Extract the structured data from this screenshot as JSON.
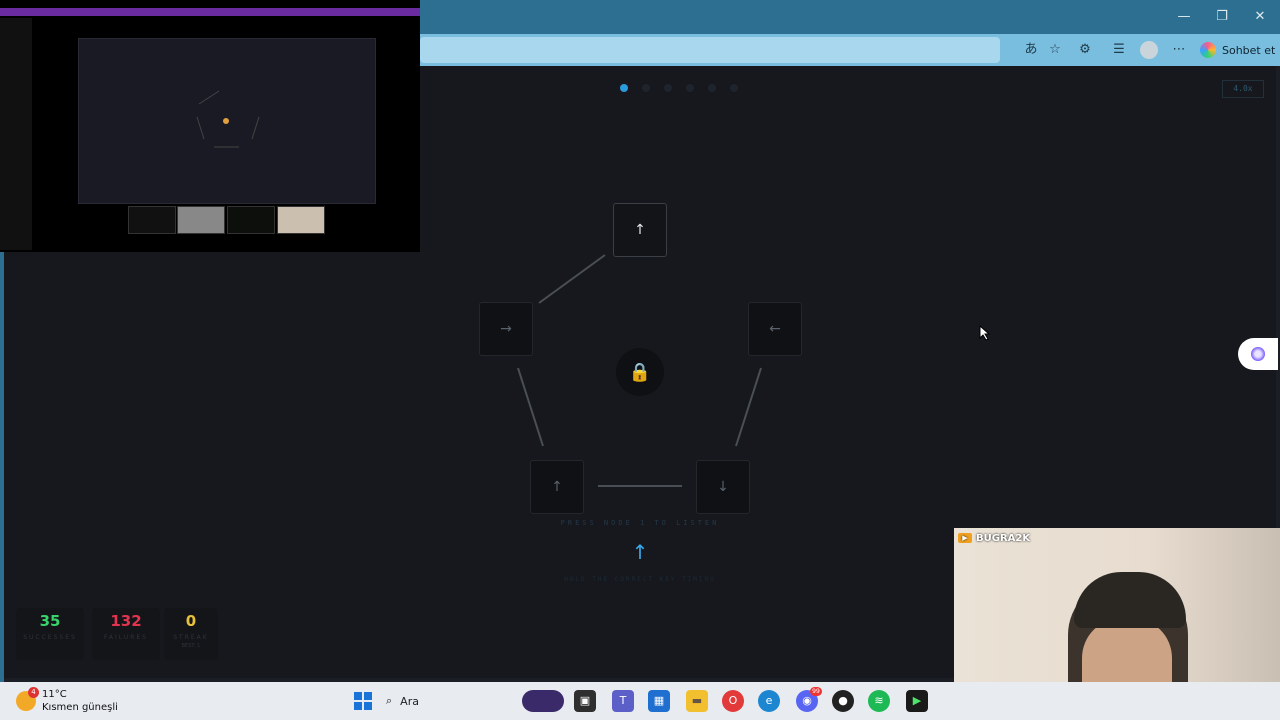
{
  "browser": {
    "copilot_label": "Sohbet et",
    "window_controls": [
      "minimize-icon",
      "restore-icon",
      "close-icon"
    ],
    "toolbar_icons": [
      "translate-icon",
      "favorite-star-icon",
      "extensions-icon",
      "favorites-icon",
      "profile-icon",
      "more-icon"
    ]
  },
  "game": {
    "progress_total": 6,
    "progress_current": 1,
    "speed_label": "4.0x",
    "nodes": [
      {
        "id": "top",
        "arrow": "↑"
      },
      {
        "id": "left",
        "arrow": "→"
      },
      {
        "id": "right",
        "arrow": "←"
      },
      {
        "id": "bottom-left",
        "arrow": "↑"
      },
      {
        "id": "bottom-right",
        "arrow": "↓"
      }
    ],
    "lock_icon": "🔒",
    "hint_top": "PRESS NODE 1 TO LISTEN",
    "big_arrow": "↑",
    "hint_bottom": "HOLD THE CORRECT KEY TIMING",
    "stats": [
      {
        "value": "35",
        "label": "SUCCESSES",
        "color": "#39d26b"
      },
      {
        "value": "132",
        "label": "FAILURES",
        "color": "#e2344f"
      },
      {
        "value": "0",
        "label": "STREAK",
        "sub": "BEST: 1",
        "color": "#e6c13a"
      }
    ]
  },
  "webcam": {
    "channel_name": "BUGRA2K"
  },
  "taskbar": {
    "weather_temp": "11°C",
    "weather_desc": "Kısmen güneşli",
    "notification_count": "4",
    "search_placeholder": "Ara",
    "discord_badge": "99"
  }
}
